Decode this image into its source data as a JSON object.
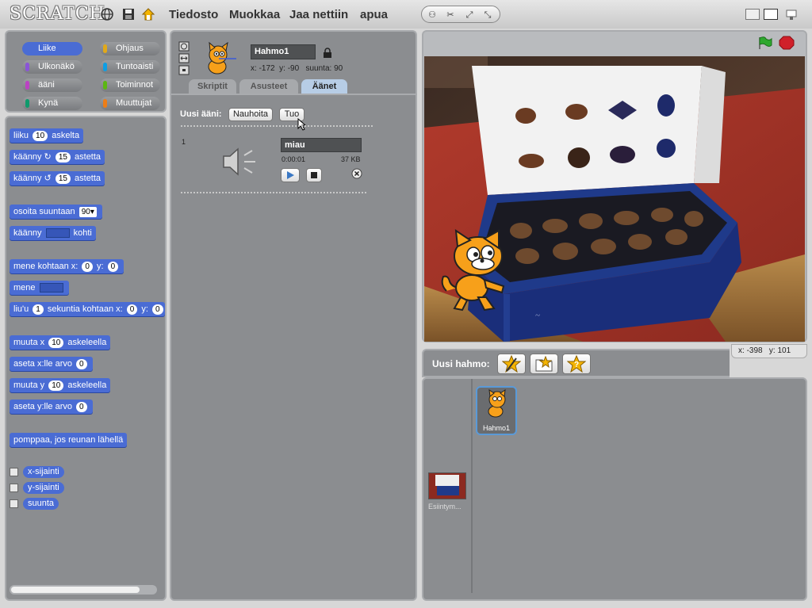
{
  "app": {
    "logo": "SCRATCH"
  },
  "menu": {
    "file": "Tiedosto",
    "edit": "Muokkaa",
    "share": "Jaa nettiin",
    "help": "apua"
  },
  "categories": [
    {
      "label": "Liike",
      "color": "#4a6cd4"
    },
    {
      "label": "Ohjaus",
      "color": "#e1a91a"
    },
    {
      "label": "Ulkonäkö",
      "color": "#8a55d7"
    },
    {
      "label": "Tuntoaisti",
      "color": "#0e9ee4"
    },
    {
      "label": "ääni",
      "color": "#bb42c3"
    },
    {
      "label": "Toiminnot",
      "color": "#5cb712"
    },
    {
      "label": "Kynä",
      "color": "#0e9a6c"
    },
    {
      "label": "Muuttujat",
      "color": "#ee7d16"
    }
  ],
  "blocks": {
    "move": {
      "pre": "liiku",
      "val": "10",
      "post": "askelta"
    },
    "turn_right": {
      "pre": "käänny",
      "val": "15",
      "post": "astetta"
    },
    "turn_left": {
      "pre": "käänny",
      "val": "15",
      "post": "astetta"
    },
    "point_dir": {
      "pre": "osoita suuntaan",
      "val": "90"
    },
    "point_towards": {
      "pre": "käänny",
      "post": "kohti"
    },
    "goto_xy": {
      "pre": "mene kohtaan x:",
      "x": "0",
      "mid": "y:",
      "y": "0"
    },
    "goto": {
      "pre": "mene"
    },
    "glide": {
      "pre": "liu'u",
      "secs": "1",
      "mid": "sekuntia kohtaan x:",
      "x": "0",
      "mid2": "y:",
      "y": "0"
    },
    "change_x": {
      "pre": "muuta x",
      "val": "10",
      "post": "askeleella"
    },
    "set_x": {
      "pre": "aseta x:lle arvo",
      "val": "0"
    },
    "change_y": {
      "pre": "muuta y",
      "val": "10",
      "post": "askeleella"
    },
    "set_y": {
      "pre": "aseta y:lle arvo",
      "val": "0"
    },
    "bounce": {
      "label": "pomppaa, jos reunan lähellä"
    },
    "reporters": [
      "x-sijainti",
      "y-sijainti",
      "suunta"
    ]
  },
  "sprite": {
    "name": "Hahmo1",
    "x_label": "x:",
    "x": "-172",
    "y_label": "y:",
    "y": "-90",
    "dir_label": "suunta:",
    "dir": "90"
  },
  "tabs": [
    "Skriptit",
    "Asusteet",
    "Äänet"
  ],
  "sounds": {
    "new_label": "Uusi ääni:",
    "record": "Nauhoita",
    "import": "Tuo",
    "items": [
      {
        "index": "1",
        "name": "miau",
        "duration": "0:00:01",
        "size": "37 KB"
      }
    ]
  },
  "stage": {
    "mouse_x_label": "x:",
    "mouse_x": "-398",
    "mouse_y_label": "y:",
    "mouse_y": "101",
    "colors": {
      "green_flag": "#2ea82e",
      "stop": "#d0202a"
    }
  },
  "sprites_pane": {
    "new_label": "Uusi hahmo:",
    "sprites": [
      {
        "name": "Hahmo1"
      }
    ],
    "stage_label": "Esiintym..."
  }
}
